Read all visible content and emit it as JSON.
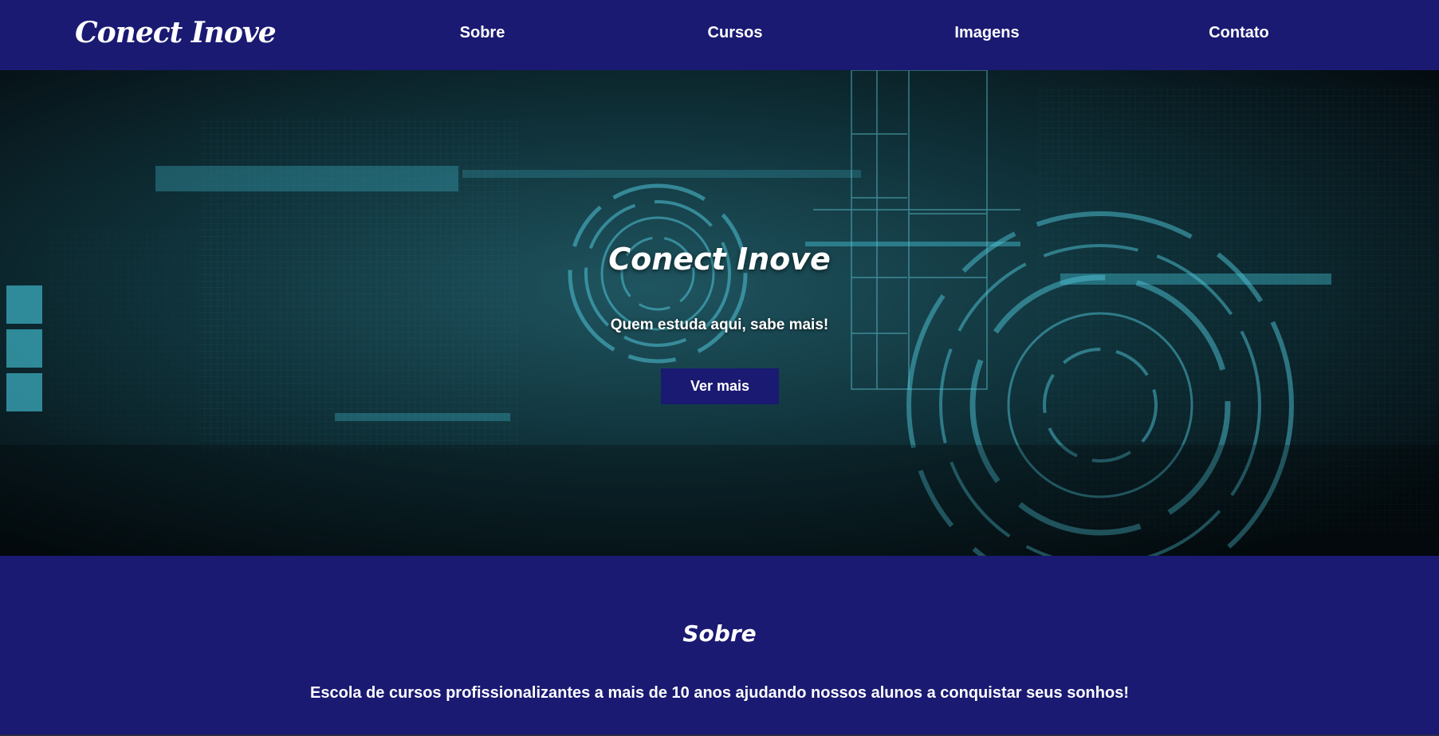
{
  "header": {
    "logo": "Conect Inove",
    "nav": [
      {
        "label": "Sobre"
      },
      {
        "label": "Cursos"
      },
      {
        "label": "Imagens"
      },
      {
        "label": "Contato"
      }
    ]
  },
  "hero": {
    "title": "Conect Inove",
    "subtitle": "Quem estuda aqui, sabe mais!",
    "button_label": "Ver mais"
  },
  "about": {
    "title": "Sobre",
    "text": "Escola de cursos profissionalizantes a mais de 10 anos ajudando nossos alunos a conquistar seus sonhos!"
  },
  "colors": {
    "primary": "#1a1a73",
    "hero_accent": "#3fb5c8",
    "text": "#ffffff"
  }
}
